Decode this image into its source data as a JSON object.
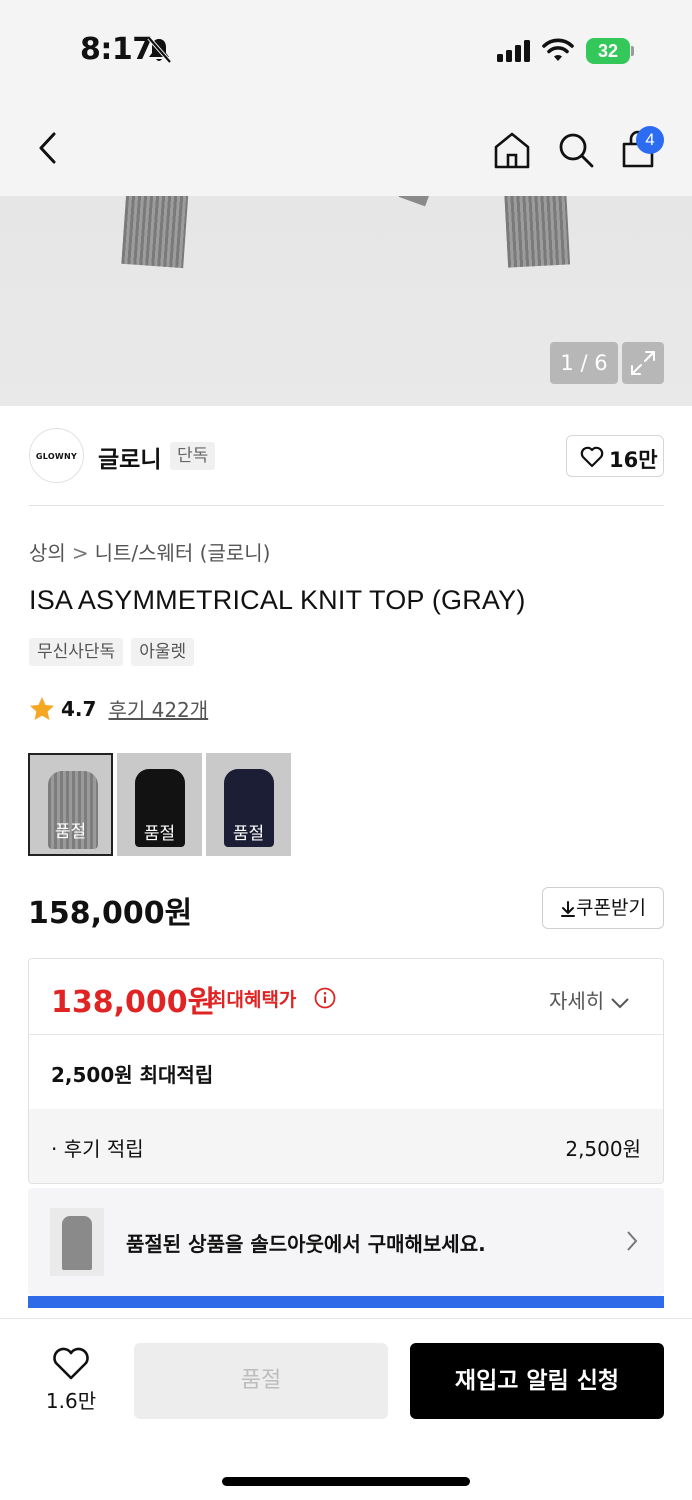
{
  "status_bar": {
    "time": "8:17",
    "battery": "32"
  },
  "nav": {
    "cart_count": "4"
  },
  "gallery": {
    "page_indicator": "1 / 6"
  },
  "brand": {
    "logo_text": "GLOWNY",
    "name": "글로니",
    "exclusive_label": "단독",
    "likes": "16만"
  },
  "product": {
    "breadcrumb": [
      "상의",
      "니트/스웨터 (글로니)"
    ],
    "title": "ISA ASYMMETRICAL KNIT TOP (GRAY)",
    "tags": [
      "무신사단독",
      "아울렛"
    ],
    "rating": "4.7",
    "review_link": "후기 422개",
    "color_options": [
      {
        "color": "#8f8f8f",
        "status": "품절",
        "selected": true
      },
      {
        "color": "#121212",
        "status": "품절",
        "selected": false
      },
      {
        "color": "#1b1e35",
        "status": "품절",
        "selected": false
      }
    ],
    "original_price": "158,000원",
    "coupon_button": "쿠폰받기"
  },
  "benefits": {
    "sale_price": "138,000원",
    "max_benefit_label": "최대혜택가",
    "detail_toggle": "자세히",
    "points_max": "2,500원 최대적립",
    "review_points_label": "· 후기 적립",
    "review_points_value": "2,500원"
  },
  "soldout_banner": {
    "text": "품절된 상품을 솔드아웃에서 구매해보세요."
  },
  "bottom_bar": {
    "wish_count": "1.6만",
    "soldout_button": "품절",
    "restock_button": "재입고 알림 신청"
  },
  "colors": {
    "sale_red": "#e02424",
    "accent_blue": "#2f6be8",
    "battery_green": "#34c759"
  }
}
